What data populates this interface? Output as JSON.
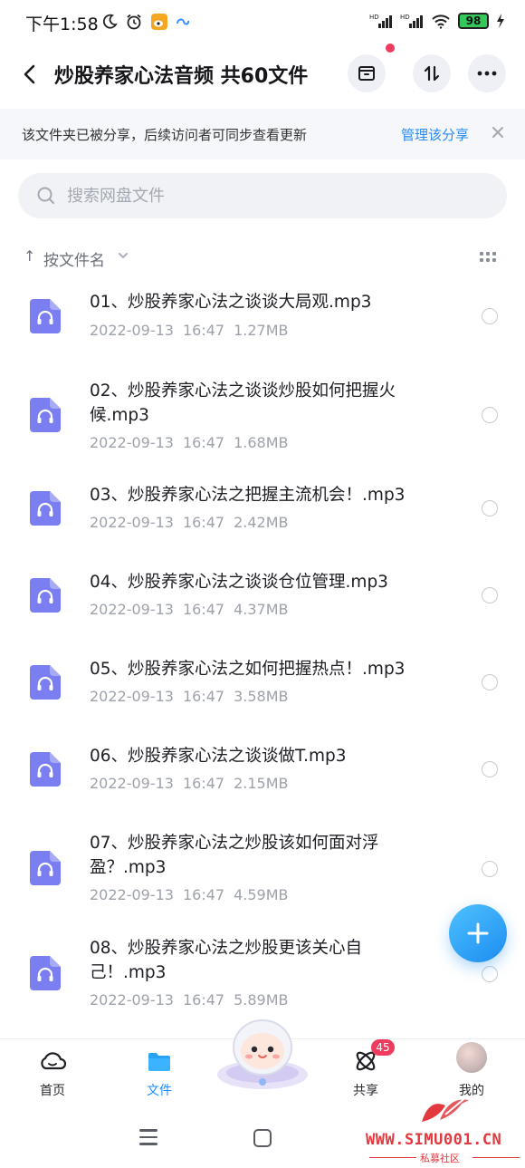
{
  "status_bar": {
    "time": "下午1:58",
    "battery": "98"
  },
  "header": {
    "title": "炒股养家心法音频 共60文件"
  },
  "banner": {
    "text": "该文件夹已被分享，后续访问者可同步查看更新",
    "link": "管理该分享"
  },
  "search": {
    "placeholder": "搜索网盘文件"
  },
  "sort": {
    "arrow": "↑",
    "label": "按文件名"
  },
  "files": [
    {
      "name": "01、炒股养家心法之谈谈大局观.mp3",
      "date": "2022-09-13",
      "time": "16:47",
      "size": "1.27MB"
    },
    {
      "name": "02、炒股养家心法之谈谈炒股如何把握火候.mp3",
      "date": "2022-09-13",
      "time": "16:47",
      "size": "1.68MB"
    },
    {
      "name": "03、炒股养家心法之把握主流机会！.mp3",
      "date": "2022-09-13",
      "time": "16:47",
      "size": "2.42MB"
    },
    {
      "name": "04、炒股养家心法之谈谈仓位管理.mp3",
      "date": "2022-09-13",
      "time": "16:47",
      "size": "4.37MB"
    },
    {
      "name": "05、炒股养家心法之如何把握热点！.mp3",
      "date": "2022-09-13",
      "time": "16:47",
      "size": "3.58MB"
    },
    {
      "name": "06、炒股养家心法之谈谈做T.mp3",
      "date": "2022-09-13",
      "time": "16:47",
      "size": "2.15MB"
    },
    {
      "name": "07、炒股养家心法之炒股该如何面对浮盈？.mp3",
      "date": "2022-09-13",
      "time": "16:47",
      "size": "4.59MB"
    },
    {
      "name": "08、炒股养家心法之炒股更该关心自己！.mp3",
      "date": "2022-09-13",
      "time": "16:47",
      "size": "5.89MB"
    }
  ],
  "bottom_nav": {
    "items": [
      {
        "label": "首页",
        "icon": "home-cloud-icon"
      },
      {
        "label": "文件",
        "icon": "folder-icon"
      },
      {
        "label": "",
        "icon": "mascot-icon"
      },
      {
        "label": "共享",
        "icon": "share-atom-icon"
      },
      {
        "label": "我的",
        "icon": "avatar"
      }
    ],
    "active": "文件",
    "share_badge": "45"
  },
  "watermark": {
    "url": "WWW.SIMU001.CN",
    "subtitle": "私募社区"
  },
  "colors": {
    "accent": "#1e90ff",
    "link": "#2a8bf2",
    "file_icon": "#7b7ef0",
    "badge": "#ef3b5e",
    "watermark": "#e2393f"
  }
}
